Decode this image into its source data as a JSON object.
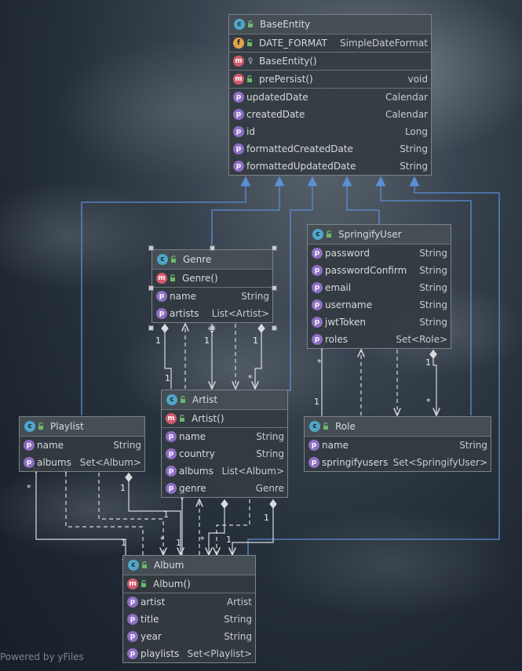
{
  "classes": {
    "base_entity": {
      "name": "BaseEntity",
      "fields": [
        {
          "name": "DATE_FORMAT",
          "type": "SimpleDateFormat"
        }
      ],
      "constructors": [
        {
          "name": "BaseEntity()"
        }
      ],
      "methods": [
        {
          "name": "prePersist()",
          "type": "void"
        }
      ],
      "properties": [
        {
          "name": "updatedDate",
          "type": "Calendar"
        },
        {
          "name": "createdDate",
          "type": "Calendar"
        },
        {
          "name": "id",
          "type": "Long"
        },
        {
          "name": "formattedCreatedDate",
          "type": "String"
        },
        {
          "name": "formattedUpdatedDate",
          "type": "String"
        }
      ]
    },
    "genre": {
      "name": "Genre",
      "constructors": [
        {
          "name": "Genre()"
        }
      ],
      "properties": [
        {
          "name": "name",
          "type": "String"
        },
        {
          "name": "artists",
          "type": "List<Artist>"
        }
      ]
    },
    "springify_user": {
      "name": "SpringifyUser",
      "properties": [
        {
          "name": "password",
          "type": "String"
        },
        {
          "name": "passwordConfirm",
          "type": "String"
        },
        {
          "name": "email",
          "type": "String"
        },
        {
          "name": "username",
          "type": "String"
        },
        {
          "name": "jwtToken",
          "type": "String"
        },
        {
          "name": "roles",
          "type": "Set<Role>"
        }
      ]
    },
    "artist": {
      "name": "Artist",
      "constructors": [
        {
          "name": "Artist()"
        }
      ],
      "properties": [
        {
          "name": "name",
          "type": "String"
        },
        {
          "name": "country",
          "type": "String"
        },
        {
          "name": "albums",
          "type": "List<Album>"
        },
        {
          "name": "genre",
          "type": "Genre"
        }
      ]
    },
    "playlist": {
      "name": "Playlist",
      "properties": [
        {
          "name": "name",
          "type": "String"
        },
        {
          "name": "albums",
          "type": "Set<Album>"
        }
      ]
    },
    "role": {
      "name": "Role",
      "properties": [
        {
          "name": "name",
          "type": "String"
        },
        {
          "name": "springifyusers",
          "type": "Set<SpringifyUser>"
        }
      ]
    },
    "album": {
      "name": "Album",
      "constructors": [
        {
          "name": "Album()"
        }
      ],
      "properties": [
        {
          "name": "artist",
          "type": "Artist"
        },
        {
          "name": "title",
          "type": "String"
        },
        {
          "name": "year",
          "type": "String"
        },
        {
          "name": "playlists",
          "type": "Set<Playlist>"
        }
      ]
    }
  },
  "badges": {
    "class": "c",
    "method": "m",
    "property": "p",
    "field": "f"
  },
  "multiplicities": {
    "one": "1",
    "many": "*"
  },
  "watermark": "Powered by yFiles",
  "colors": {
    "inheritance": "#5b8fd6",
    "association": "#d8dadc",
    "badge_class": "#4fa6c8",
    "badge_method": "#d15b6e",
    "badge_property": "#8e6ec2",
    "badge_field": "#e0a34a"
  }
}
